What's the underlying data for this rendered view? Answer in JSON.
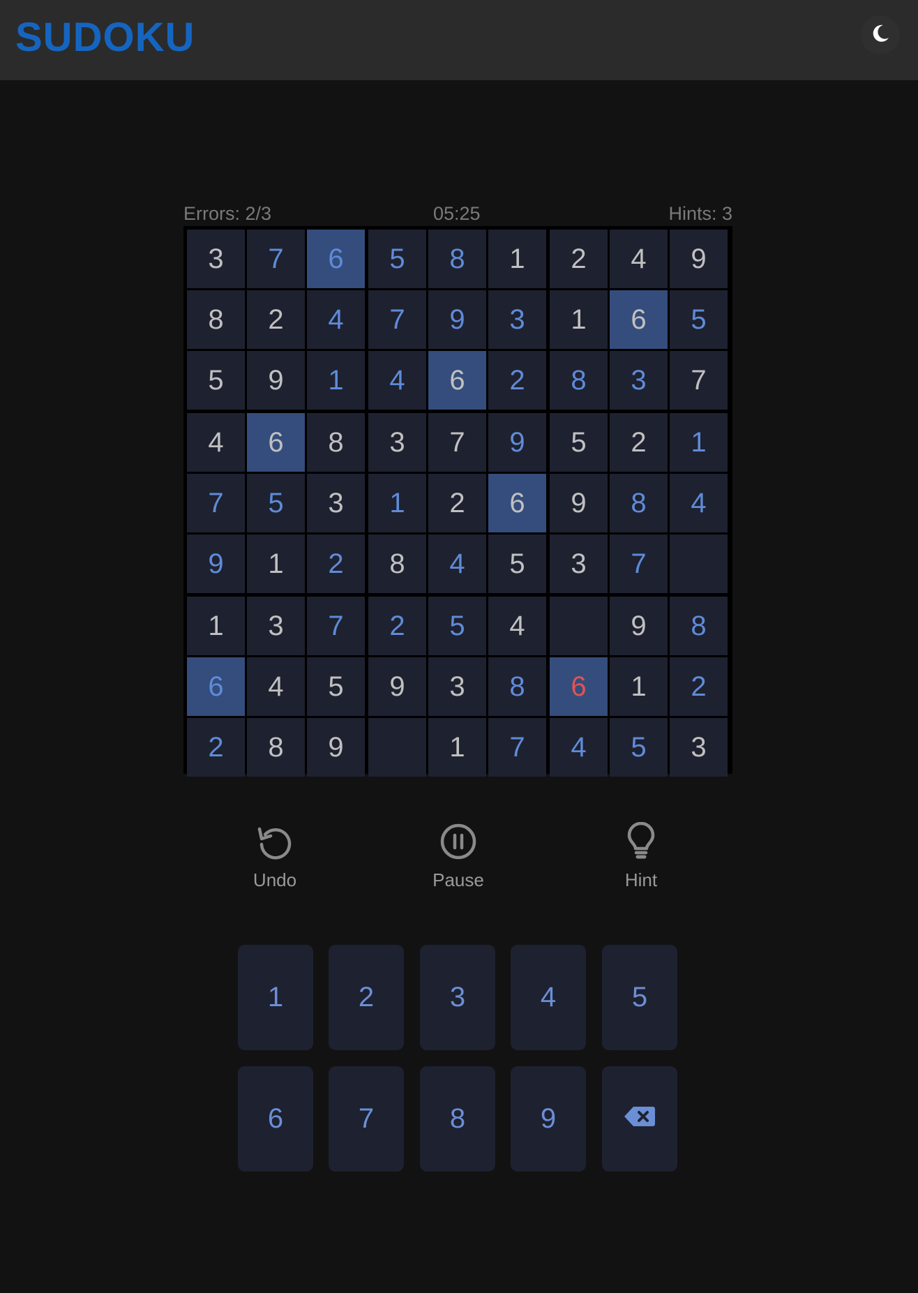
{
  "app": {
    "title": "SUDOKU"
  },
  "header": {
    "theme_icon": "moon-icon"
  },
  "status": {
    "errors": "Errors: 2/3",
    "timer": "05:25",
    "hints": "Hints: 3"
  },
  "board": {
    "cells": [
      [
        {
          "v": "3",
          "t": "given"
        },
        {
          "v": "7",
          "t": "user"
        },
        {
          "v": "6",
          "t": "user",
          "hl": true
        },
        {
          "v": "5",
          "t": "user"
        },
        {
          "v": "8",
          "t": "user"
        },
        {
          "v": "1",
          "t": "given"
        },
        {
          "v": "2",
          "t": "given"
        },
        {
          "v": "4",
          "t": "given"
        },
        {
          "v": "9",
          "t": "given"
        }
      ],
      [
        {
          "v": "8",
          "t": "given"
        },
        {
          "v": "2",
          "t": "given"
        },
        {
          "v": "4",
          "t": "user"
        },
        {
          "v": "7",
          "t": "user"
        },
        {
          "v": "9",
          "t": "user"
        },
        {
          "v": "3",
          "t": "user"
        },
        {
          "v": "1",
          "t": "given"
        },
        {
          "v": "6",
          "t": "given",
          "hl": true
        },
        {
          "v": "5",
          "t": "user"
        }
      ],
      [
        {
          "v": "5",
          "t": "given"
        },
        {
          "v": "9",
          "t": "given"
        },
        {
          "v": "1",
          "t": "user"
        },
        {
          "v": "4",
          "t": "user"
        },
        {
          "v": "6",
          "t": "given",
          "hl": true
        },
        {
          "v": "2",
          "t": "user"
        },
        {
          "v": "8",
          "t": "user"
        },
        {
          "v": "3",
          "t": "user"
        },
        {
          "v": "7",
          "t": "given"
        }
      ],
      [
        {
          "v": "4",
          "t": "given"
        },
        {
          "v": "6",
          "t": "given",
          "hl": true
        },
        {
          "v": "8",
          "t": "given"
        },
        {
          "v": "3",
          "t": "given"
        },
        {
          "v": "7",
          "t": "given"
        },
        {
          "v": "9",
          "t": "user"
        },
        {
          "v": "5",
          "t": "given"
        },
        {
          "v": "2",
          "t": "given"
        },
        {
          "v": "1",
          "t": "user"
        }
      ],
      [
        {
          "v": "7",
          "t": "user"
        },
        {
          "v": "5",
          "t": "user"
        },
        {
          "v": "3",
          "t": "given"
        },
        {
          "v": "1",
          "t": "user"
        },
        {
          "v": "2",
          "t": "given"
        },
        {
          "v": "6",
          "t": "given",
          "hl": true
        },
        {
          "v": "9",
          "t": "given"
        },
        {
          "v": "8",
          "t": "user"
        },
        {
          "v": "4",
          "t": "user"
        }
      ],
      [
        {
          "v": "9",
          "t": "user"
        },
        {
          "v": "1",
          "t": "given"
        },
        {
          "v": "2",
          "t": "user"
        },
        {
          "v": "8",
          "t": "given"
        },
        {
          "v": "4",
          "t": "user"
        },
        {
          "v": "5",
          "t": "given"
        },
        {
          "v": "3",
          "t": "given"
        },
        {
          "v": "7",
          "t": "user"
        },
        {
          "v": "",
          "t": "empty"
        }
      ],
      [
        {
          "v": "1",
          "t": "given"
        },
        {
          "v": "3",
          "t": "given"
        },
        {
          "v": "7",
          "t": "user"
        },
        {
          "v": "2",
          "t": "user"
        },
        {
          "v": "5",
          "t": "user"
        },
        {
          "v": "4",
          "t": "given"
        },
        {
          "v": "",
          "t": "empty"
        },
        {
          "v": "9",
          "t": "given"
        },
        {
          "v": "8",
          "t": "user"
        }
      ],
      [
        {
          "v": "6",
          "t": "user",
          "hl": true
        },
        {
          "v": "4",
          "t": "given"
        },
        {
          "v": "5",
          "t": "given"
        },
        {
          "v": "9",
          "t": "given"
        },
        {
          "v": "3",
          "t": "given"
        },
        {
          "v": "8",
          "t": "user"
        },
        {
          "v": "6",
          "t": "error",
          "hl": true
        },
        {
          "v": "1",
          "t": "given"
        },
        {
          "v": "2",
          "t": "user"
        }
      ],
      [
        {
          "v": "2",
          "t": "user"
        },
        {
          "v": "8",
          "t": "given"
        },
        {
          "v": "9",
          "t": "given"
        },
        {
          "v": "",
          "t": "empty"
        },
        {
          "v": "1",
          "t": "given"
        },
        {
          "v": "7",
          "t": "user"
        },
        {
          "v": "4",
          "t": "user"
        },
        {
          "v": "5",
          "t": "user"
        },
        {
          "v": "3",
          "t": "given"
        }
      ]
    ]
  },
  "actions": [
    {
      "label": "Undo",
      "icon": "undo-icon"
    },
    {
      "label": "Pause",
      "icon": "pause-icon"
    },
    {
      "label": "Hint",
      "icon": "lightbulb-icon"
    }
  ],
  "numpad": {
    "keys": [
      "1",
      "2",
      "3",
      "4",
      "5",
      "6",
      "7",
      "8",
      "9"
    ],
    "erase_icon": "backspace-icon"
  },
  "colors": {
    "logo": "#1565c0",
    "given_digit": "#c0c0c0",
    "user_digit": "#5f8bd8",
    "error_digit": "#e05353",
    "highlight": "#344d7c",
    "cell_bg": "#1e2130"
  }
}
